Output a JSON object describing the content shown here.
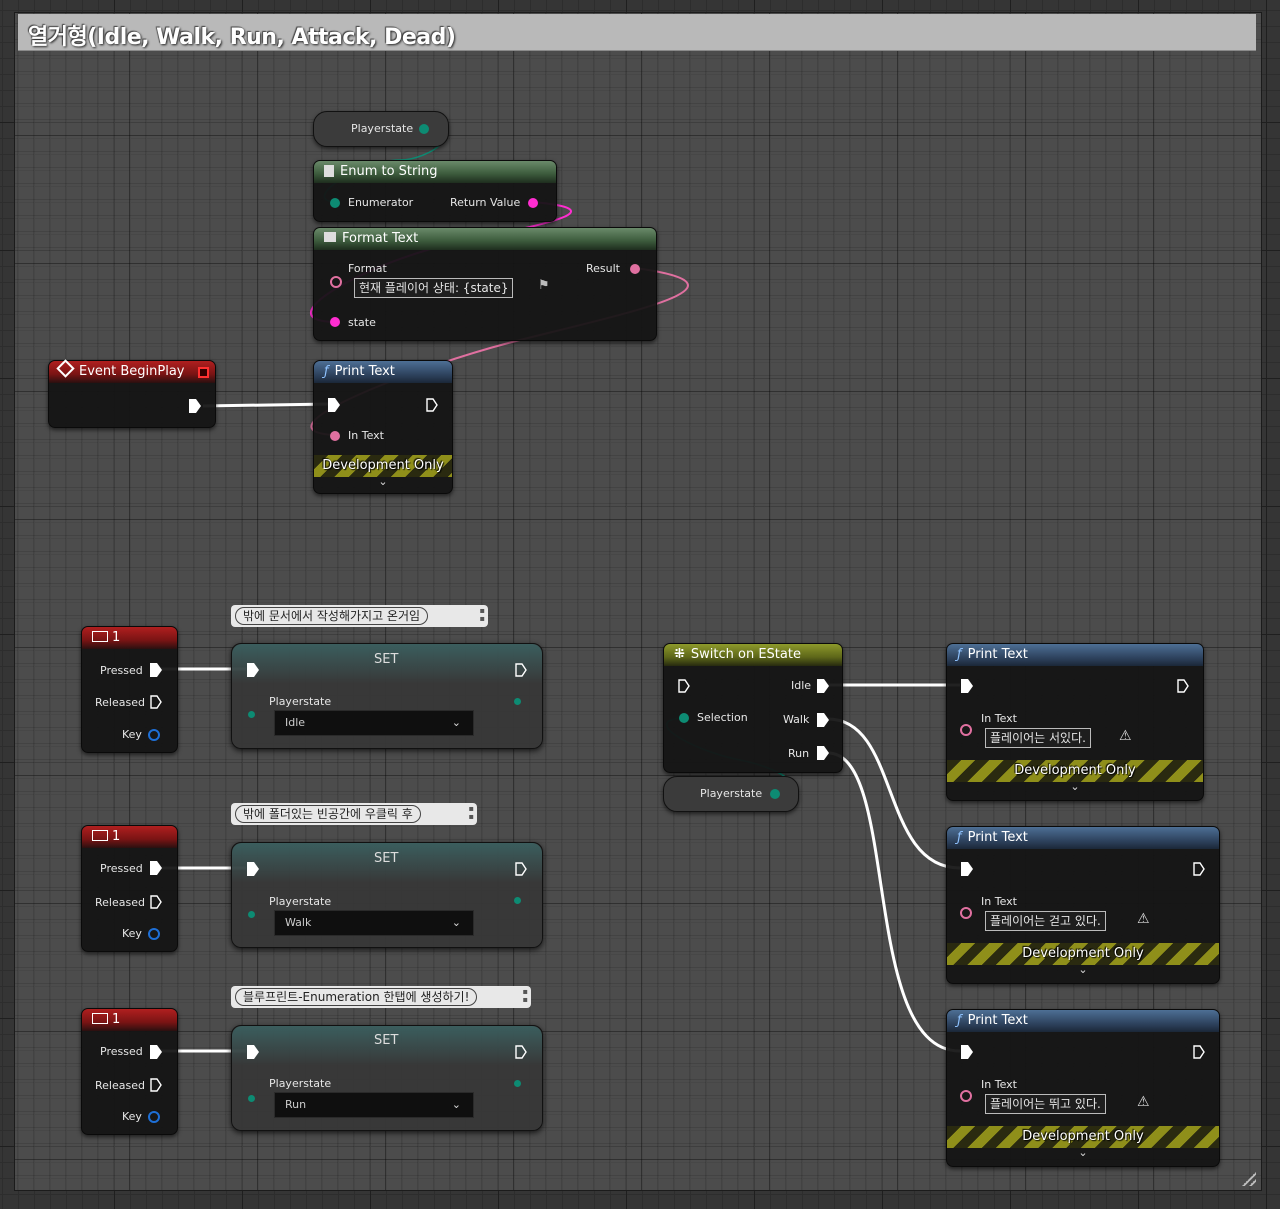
{
  "comment": {
    "title": "열거형(Idle, Walk, Run, Attack, Dead)"
  },
  "colors": {
    "exec": "#ffffff",
    "text_pin": "#e070a0",
    "string_pin": "#ff2dd1",
    "enum_pin": "#0d8b73",
    "key_pin": "#1e6fd6"
  },
  "nodes": {
    "var_top": {
      "label": "Playerstate"
    },
    "enum_to_string": {
      "title": "Enum to String",
      "icon": "document-icon",
      "enumerator": "Enumerator",
      "return_value": "Return Value"
    },
    "format_text": {
      "title": "Format Text",
      "icon": "document-icon",
      "format_label": "Format",
      "format_value": "현재 플레이어 상태: {state}",
      "result": "Result",
      "state": "state"
    },
    "event_begin_play": {
      "title": "Event BeginPlay",
      "icon": "event-diamond-icon"
    },
    "print_text_top": {
      "title": "Print Text",
      "in_text": "In Text",
      "dev_only": "Development Only"
    },
    "key1_a": {
      "title": "1",
      "pressed": "Pressed",
      "released": "Released",
      "key": "Key"
    },
    "key1_b": {
      "title": "1",
      "pressed": "Pressed",
      "released": "Released",
      "key": "Key"
    },
    "key1_c": {
      "title": "1",
      "pressed": "Pressed",
      "released": "Released",
      "key": "Key"
    },
    "set_a": {
      "title": "SET",
      "var_label": "Playerstate",
      "value": "Idle",
      "comment": "밖에 문서에서 작성해가지고 온거임"
    },
    "set_b": {
      "title": "SET",
      "var_label": "Playerstate",
      "value": "Walk",
      "comment": "밖에 폴더있는 빈공간에 우클릭 후"
    },
    "set_c": {
      "title": "SET",
      "var_label": "Playerstate",
      "value": "Run",
      "comment": "블루프린트-Enumeration 한탭에 생성하기!"
    },
    "switch": {
      "title": "Switch on EState",
      "selection": "Selection",
      "idle": "Idle",
      "walk": "Walk",
      "run": "Run"
    },
    "var_switch": {
      "label": "Playerstate"
    },
    "print_idle": {
      "title": "Print Text",
      "in_text": "In Text",
      "value": "플레이어는 서있다.",
      "dev_only": "Development Only"
    },
    "print_walk": {
      "title": "Print Text",
      "in_text": "In Text",
      "value": "플레이어는 걷고 있다.",
      "dev_only": "Development Only"
    },
    "print_run": {
      "title": "Print Text",
      "in_text": "In Text",
      "value": "플레이어는 뛰고 있다.",
      "dev_only": "Development Only"
    }
  }
}
